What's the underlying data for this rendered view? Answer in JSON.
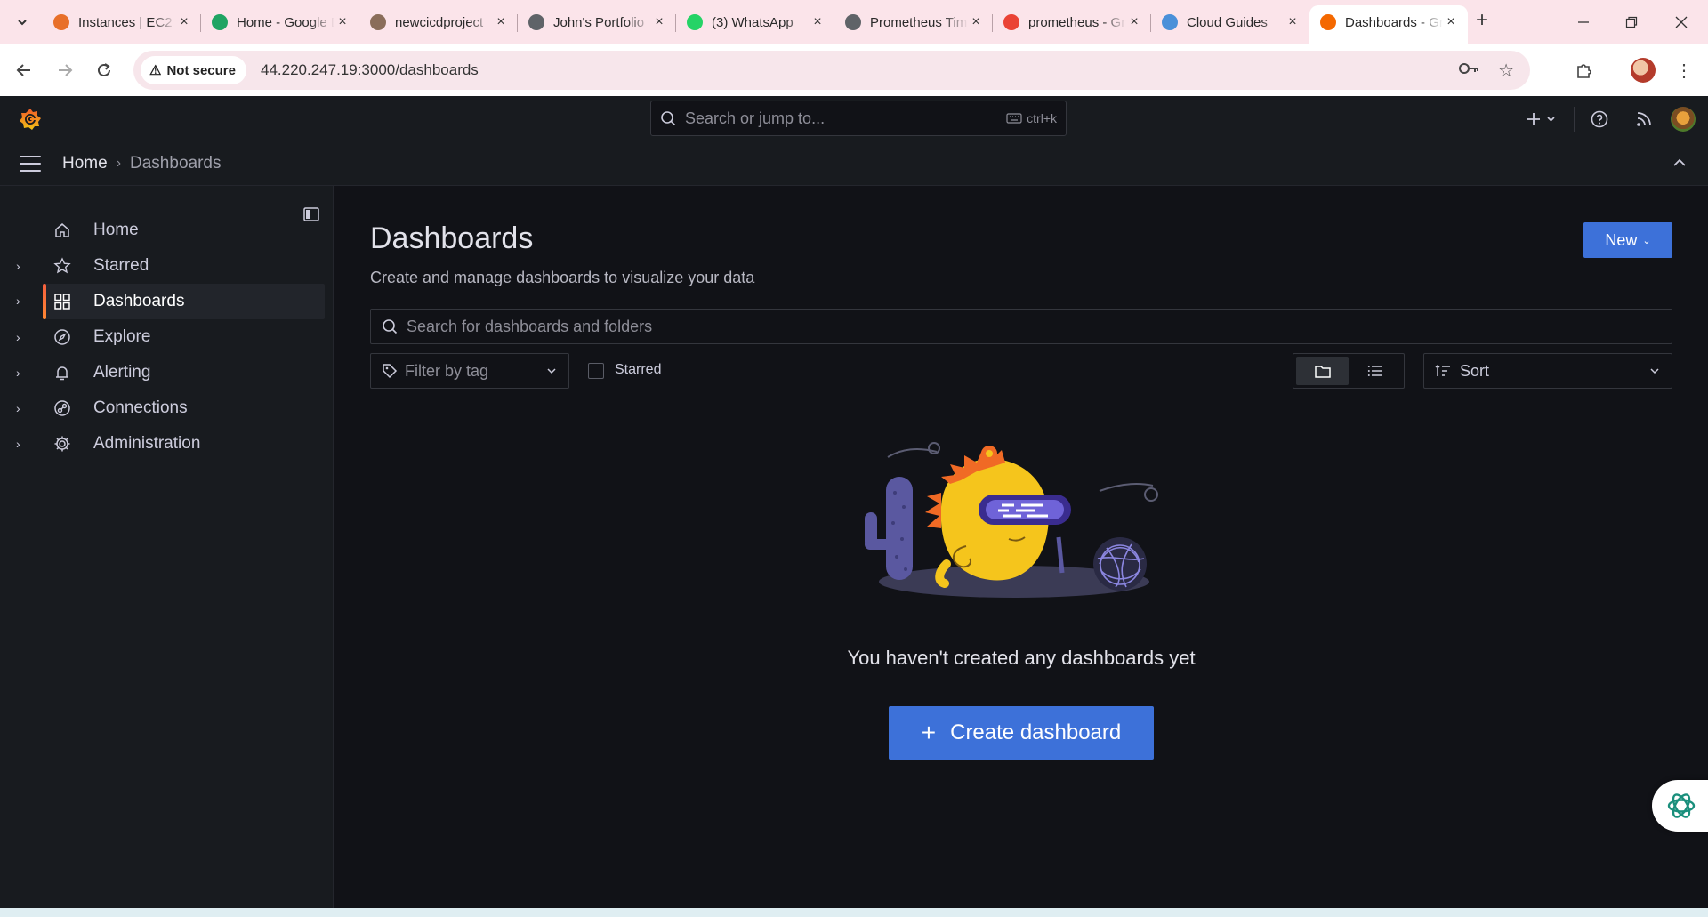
{
  "browser": {
    "tabs": [
      {
        "title": "Instances | EC2",
        "favicon_color": "#e8702a"
      },
      {
        "title": "Home - Google Drive",
        "favicon_color": "#1fa463"
      },
      {
        "title": "newcicdproject",
        "favicon_color": "#8a6d5a"
      },
      {
        "title": "John's Portfolio",
        "favicon_color": "#5f6368"
      },
      {
        "title": "(3) WhatsApp",
        "favicon_color": "#25d366"
      },
      {
        "title": "Prometheus Time Series",
        "favicon_color": "#5f6368"
      },
      {
        "title": "prometheus - Gmail",
        "favicon_color": "#ea4335"
      },
      {
        "title": "Cloud Guides",
        "favicon_color": "#4a90d9"
      },
      {
        "title": "Dashboards - Grafana",
        "favicon_color": "#f46800"
      }
    ],
    "active_tab_index": 8,
    "security_label": "Not secure",
    "url": "44.220.247.19:3000/dashboards"
  },
  "grafana": {
    "search_placeholder": "Search or jump to...",
    "search_shortcut": "ctrl+k",
    "breadcrumb": {
      "home": "Home",
      "current": "Dashboards"
    },
    "nav": [
      {
        "label": "Home",
        "icon": "home-icon",
        "has_chevron": false
      },
      {
        "label": "Starred",
        "icon": "star-icon",
        "has_chevron": true
      },
      {
        "label": "Dashboards",
        "icon": "apps-icon",
        "has_chevron": true,
        "active": true
      },
      {
        "label": "Explore",
        "icon": "compass-icon",
        "has_chevron": true
      },
      {
        "label": "Alerting",
        "icon": "bell-icon",
        "has_chevron": true
      },
      {
        "label": "Connections",
        "icon": "link-icon",
        "has_chevron": true
      },
      {
        "label": "Administration",
        "icon": "cog-icon",
        "has_chevron": true
      }
    ],
    "page": {
      "title": "Dashboards",
      "subtitle": "Create and manage dashboards to visualize your data",
      "new_button": "New",
      "search_placeholder": "Search for dashboards and folders",
      "filter_tag_placeholder": "Filter by tag",
      "starred_label": "Starred",
      "sort_label": "Sort",
      "empty_message": "You haven't created any dashboards yet",
      "create_button": "Create dashboard"
    }
  },
  "colors": {
    "accent": "#3d71d9",
    "active_indicator": "#f55f3e",
    "background": "#111217",
    "panel": "#181b1f"
  }
}
